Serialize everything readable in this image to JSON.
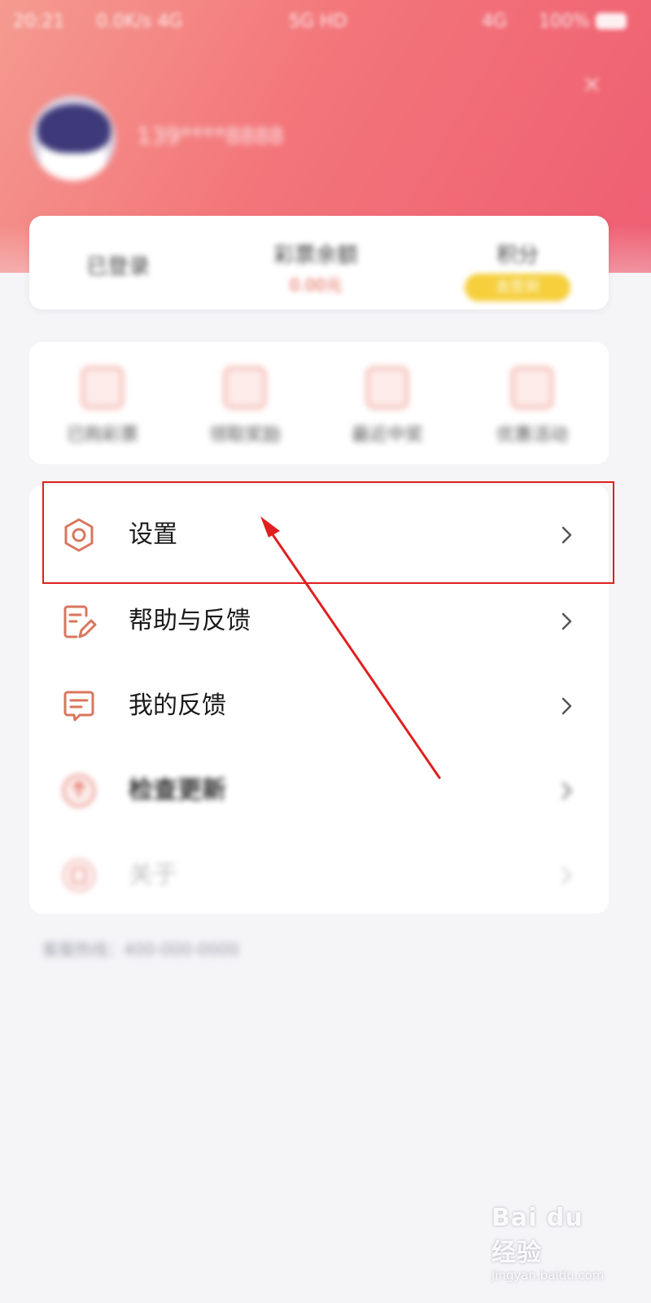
{
  "status_bar": {
    "time": "20:21",
    "network": "0.0K/s 4G",
    "carrier": "5G HD",
    "signal": "4G",
    "battery": "100%"
  },
  "profile": {
    "username": "139****8888"
  },
  "stats": {
    "left_title": "已登录",
    "middle_title": "彩票余额",
    "middle_sub": "0.00元",
    "right_title": "积分",
    "right_pill": "去签到"
  },
  "quick_actions": [
    {
      "label": "已购彩票",
      "icon": "ticket-icon"
    },
    {
      "label": "领取奖励",
      "icon": "gift-icon"
    },
    {
      "label": "最近中奖",
      "icon": "trophy-icon"
    },
    {
      "label": "优惠活动",
      "icon": "coupon-icon"
    }
  ],
  "menu": [
    {
      "label": "设置",
      "icon": "settings-hexagon-icon"
    },
    {
      "label": "帮助与反馈",
      "icon": "document-edit-icon"
    },
    {
      "label": "我的反馈",
      "icon": "message-icon"
    },
    {
      "label": "检查更新",
      "icon": "update-icon"
    },
    {
      "label": "关于",
      "icon": "info-icon"
    }
  ],
  "footer_note": "客服热线：400-000-0000",
  "watermark": {
    "main": "Bai du 经验",
    "sub": "jingyan.baidu.com"
  },
  "colors": {
    "accent": "#f06b74",
    "highlight": "#e02020",
    "icon_stroke": "#d9765e"
  }
}
